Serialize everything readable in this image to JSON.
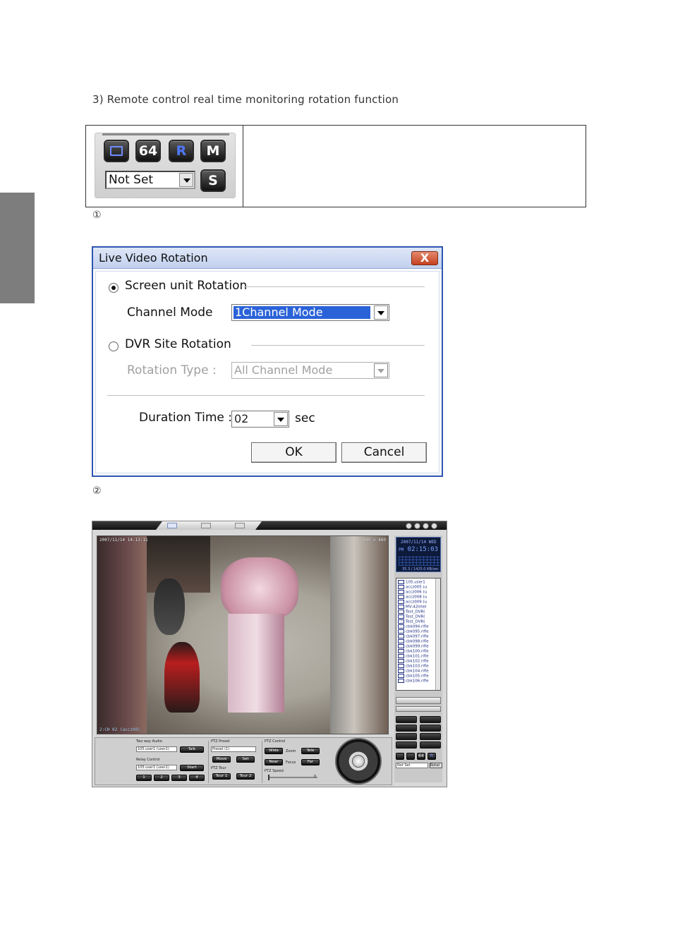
{
  "heading": "3) Remote control real time monitoring rotation function",
  "figure1": {
    "number": "①",
    "buttons": [
      {
        "label": "",
        "icon": "screen-icon"
      },
      {
        "label": "64"
      },
      {
        "label": "R"
      },
      {
        "label": "M"
      }
    ],
    "select_value": "Not Set",
    "s_button": "S"
  },
  "figure2": {
    "number": "②",
    "dialog": {
      "title": "Live Video Rotation",
      "close_label": "X",
      "screen_rotation_label": "Screen unit Rotation",
      "screen_rotation_checked": true,
      "channel_mode_label": "Channel Mode",
      "channel_mode_value": "1Channel Mode",
      "dvr_rotation_label": "DVR Site Rotation",
      "dvr_rotation_checked": false,
      "rotation_type_label": "Rotation Type :",
      "rotation_type_value": "All Channel Mode",
      "duration_label": "Duration Time :",
      "duration_value": "02",
      "duration_unit": "sec",
      "ok_label": "OK",
      "cancel_label": "Cancel"
    }
  },
  "app": {
    "video": {
      "timestamp": "2007/11/14 14:13:11",
      "resolution": "640 x 480",
      "channel_label": "2:CH 02 (accz00)"
    },
    "clock": {
      "date": "2007/11/14 WED",
      "ampm": "PM",
      "time": "02:15:03",
      "rate": "35.3 / 1425.0 KB/sec"
    },
    "sites": [
      "105.user1",
      "accz005 (u",
      "accz006 (u",
      "accz008 (u",
      "accz009 (u",
      "MV-42Intel",
      "Test_DVR(",
      "Test_DVR(",
      "Test_DVR(",
      "cbk094.rifle",
      "cbk095.rifle",
      "cbk097.rifle",
      "cbk098.rifle",
      "cbk099.rifle",
      "cbk100.rifle",
      "cbk101.rifle",
      "cbk102.rifle",
      "cbk103.rifle",
      "cbk104.rifle",
      "cbk105.rifle",
      "cbk106.rifle"
    ],
    "rp_keys": [
      "64",
      "R"
    ],
    "rp_select": "Not Set",
    "rp_rotation": "Rotat",
    "bottom": {
      "two_way_audio": "Two way Audio",
      "audio_select": "105.user1 (user1)",
      "talk": "Talk",
      "relay_control": "Relay Control",
      "relay_select": "105.user1 (user1)",
      "start": "Start",
      "relay_keys": [
        "1",
        "2",
        "3",
        "4"
      ],
      "ptz_preset": "PTZ Preset",
      "preset_select": "Preset (1)",
      "move": "Move",
      "set": "Set",
      "ptz_tour": "PTZ Tour",
      "tour1": "Tour 1",
      "tour2": "Tour 2",
      "ptz_control": "PTZ Control",
      "wide": "Wide",
      "zoom": "Zoom",
      "tele": "Tele",
      "near": "Near",
      "focus": "Focus",
      "far": "Far",
      "ptz_speed": "PTZ Speed",
      "speed_value": "0"
    }
  }
}
